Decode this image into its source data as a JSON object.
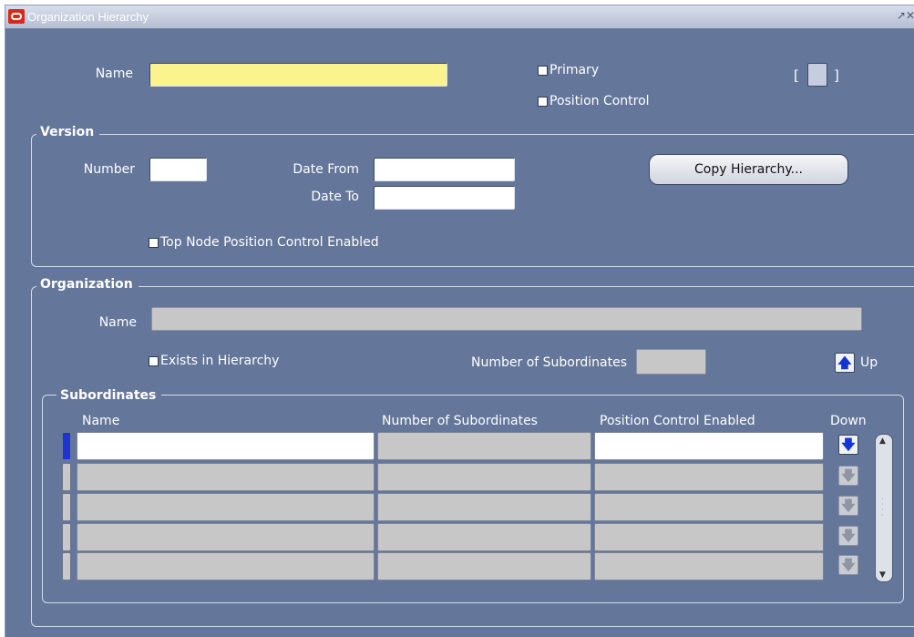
{
  "window": {
    "title": "Organization Hierarchy",
    "controls": "↗✕"
  },
  "header": {
    "name_label": "Name",
    "name_value": "",
    "primary_label": "Primary",
    "primary_checked": false,
    "position_control_label": "Position Control",
    "position_control_checked": false,
    "bracket_open": "[",
    "bracket_close": "]"
  },
  "version": {
    "title": "Version",
    "number_label": "Number",
    "number_value": "",
    "date_from_label": "Date From",
    "date_from_value": "",
    "date_to_label": "Date To",
    "date_to_value": "",
    "copy_button_label": "Copy Hierarchy...",
    "top_node_label": "Top Node Position Control Enabled",
    "top_node_checked": false
  },
  "organization": {
    "title": "Organization",
    "name_label": "Name",
    "name_value": "",
    "exists_label": "Exists in Hierarchy",
    "exists_checked": false,
    "num_sub_label": "Number of Subordinates",
    "num_sub_value": "",
    "up_label": "Up"
  },
  "subordinates": {
    "title": "Subordinates",
    "columns": [
      "Name",
      "Number of Subordinates",
      "Position Control Enabled",
      "Down"
    ],
    "rows": [
      {
        "name": "",
        "num": "",
        "pos": ""
      },
      {
        "name": "",
        "num": "",
        "pos": ""
      },
      {
        "name": "",
        "num": "",
        "pos": ""
      },
      {
        "name": "",
        "num": "",
        "pos": ""
      },
      {
        "name": "",
        "num": "",
        "pos": ""
      }
    ]
  },
  "colors": {
    "background": "#64769a",
    "required_field": "#fbf48e",
    "arrow_blue": "#1435d1"
  }
}
